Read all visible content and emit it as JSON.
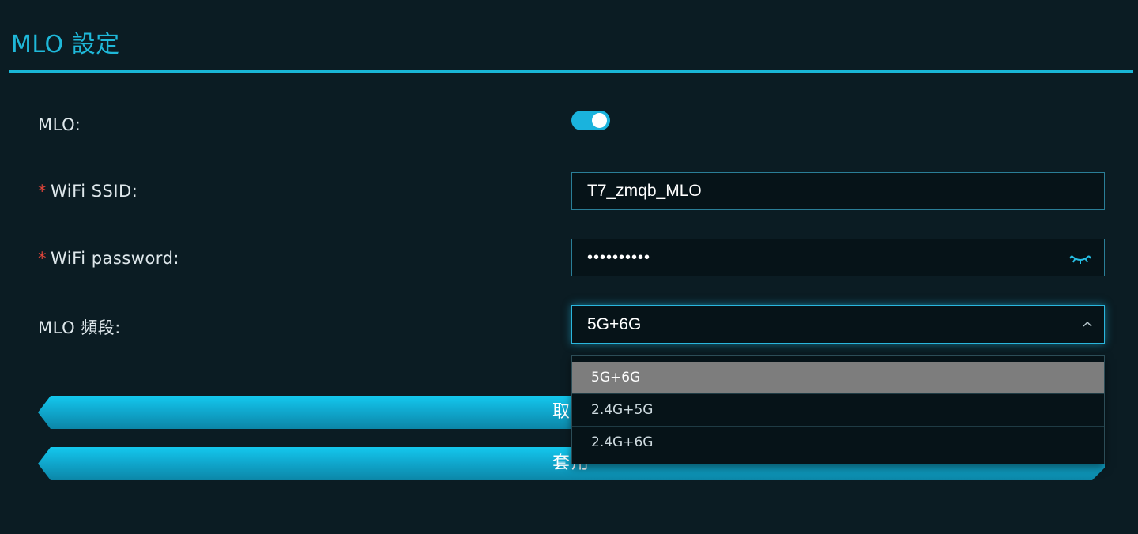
{
  "header": {
    "title": "MLO 設定"
  },
  "form": {
    "mlo": {
      "label": "MLO:",
      "enabled": true
    },
    "ssid": {
      "required_mark": "*",
      "label": "WiFi SSID:",
      "value": "T7_zmqb_MLO"
    },
    "password": {
      "required_mark": "*",
      "label": "WiFi password:",
      "masked_value": "••••••••••"
    },
    "band": {
      "label": "MLO 頻段:",
      "selected": "5G+6G",
      "options": [
        "5G+6G",
        "2.4G+5G",
        "2.4G+6G"
      ]
    }
  },
  "buttons": {
    "cancel": "取消",
    "apply": "套用"
  },
  "icons": {
    "password_toggle": "eye-closed-icon",
    "dropdown_caret": "chevron-up-icon"
  },
  "colors": {
    "accent": "#1fb8d9",
    "required": "#e0453a",
    "background": "#0b1c23"
  }
}
